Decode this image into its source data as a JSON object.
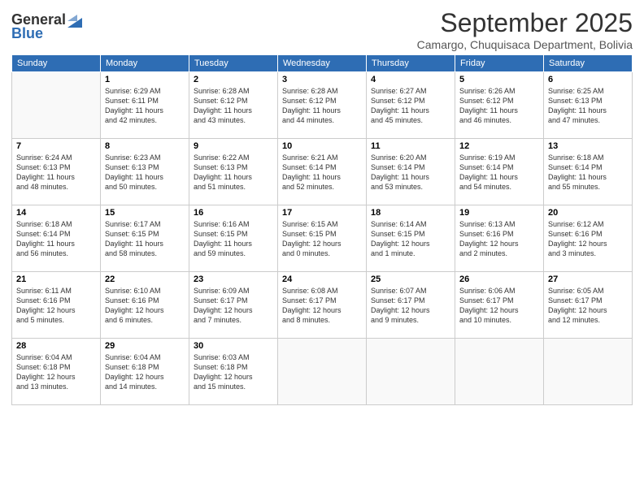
{
  "header": {
    "logo_line1": "General",
    "logo_line2": "Blue",
    "month": "September 2025",
    "location": "Camargo, Chuquisaca Department, Bolivia"
  },
  "days_of_week": [
    "Sunday",
    "Monday",
    "Tuesday",
    "Wednesday",
    "Thursday",
    "Friday",
    "Saturday"
  ],
  "weeks": [
    [
      {
        "day": "",
        "info": ""
      },
      {
        "day": "1",
        "info": "Sunrise: 6:29 AM\nSunset: 6:11 PM\nDaylight: 11 hours\nand 42 minutes."
      },
      {
        "day": "2",
        "info": "Sunrise: 6:28 AM\nSunset: 6:12 PM\nDaylight: 11 hours\nand 43 minutes."
      },
      {
        "day": "3",
        "info": "Sunrise: 6:28 AM\nSunset: 6:12 PM\nDaylight: 11 hours\nand 44 minutes."
      },
      {
        "day": "4",
        "info": "Sunrise: 6:27 AM\nSunset: 6:12 PM\nDaylight: 11 hours\nand 45 minutes."
      },
      {
        "day": "5",
        "info": "Sunrise: 6:26 AM\nSunset: 6:12 PM\nDaylight: 11 hours\nand 46 minutes."
      },
      {
        "day": "6",
        "info": "Sunrise: 6:25 AM\nSunset: 6:13 PM\nDaylight: 11 hours\nand 47 minutes."
      }
    ],
    [
      {
        "day": "7",
        "info": "Sunrise: 6:24 AM\nSunset: 6:13 PM\nDaylight: 11 hours\nand 48 minutes."
      },
      {
        "day": "8",
        "info": "Sunrise: 6:23 AM\nSunset: 6:13 PM\nDaylight: 11 hours\nand 50 minutes."
      },
      {
        "day": "9",
        "info": "Sunrise: 6:22 AM\nSunset: 6:13 PM\nDaylight: 11 hours\nand 51 minutes."
      },
      {
        "day": "10",
        "info": "Sunrise: 6:21 AM\nSunset: 6:14 PM\nDaylight: 11 hours\nand 52 minutes."
      },
      {
        "day": "11",
        "info": "Sunrise: 6:20 AM\nSunset: 6:14 PM\nDaylight: 11 hours\nand 53 minutes."
      },
      {
        "day": "12",
        "info": "Sunrise: 6:19 AM\nSunset: 6:14 PM\nDaylight: 11 hours\nand 54 minutes."
      },
      {
        "day": "13",
        "info": "Sunrise: 6:18 AM\nSunset: 6:14 PM\nDaylight: 11 hours\nand 55 minutes."
      }
    ],
    [
      {
        "day": "14",
        "info": "Sunrise: 6:18 AM\nSunset: 6:14 PM\nDaylight: 11 hours\nand 56 minutes."
      },
      {
        "day": "15",
        "info": "Sunrise: 6:17 AM\nSunset: 6:15 PM\nDaylight: 11 hours\nand 58 minutes."
      },
      {
        "day": "16",
        "info": "Sunrise: 6:16 AM\nSunset: 6:15 PM\nDaylight: 11 hours\nand 59 minutes."
      },
      {
        "day": "17",
        "info": "Sunrise: 6:15 AM\nSunset: 6:15 PM\nDaylight: 12 hours\nand 0 minutes."
      },
      {
        "day": "18",
        "info": "Sunrise: 6:14 AM\nSunset: 6:15 PM\nDaylight: 12 hours\nand 1 minute."
      },
      {
        "day": "19",
        "info": "Sunrise: 6:13 AM\nSunset: 6:16 PM\nDaylight: 12 hours\nand 2 minutes."
      },
      {
        "day": "20",
        "info": "Sunrise: 6:12 AM\nSunset: 6:16 PM\nDaylight: 12 hours\nand 3 minutes."
      }
    ],
    [
      {
        "day": "21",
        "info": "Sunrise: 6:11 AM\nSunset: 6:16 PM\nDaylight: 12 hours\nand 5 minutes."
      },
      {
        "day": "22",
        "info": "Sunrise: 6:10 AM\nSunset: 6:16 PM\nDaylight: 12 hours\nand 6 minutes."
      },
      {
        "day": "23",
        "info": "Sunrise: 6:09 AM\nSunset: 6:17 PM\nDaylight: 12 hours\nand 7 minutes."
      },
      {
        "day": "24",
        "info": "Sunrise: 6:08 AM\nSunset: 6:17 PM\nDaylight: 12 hours\nand 8 minutes."
      },
      {
        "day": "25",
        "info": "Sunrise: 6:07 AM\nSunset: 6:17 PM\nDaylight: 12 hours\nand 9 minutes."
      },
      {
        "day": "26",
        "info": "Sunrise: 6:06 AM\nSunset: 6:17 PM\nDaylight: 12 hours\nand 10 minutes."
      },
      {
        "day": "27",
        "info": "Sunrise: 6:05 AM\nSunset: 6:17 PM\nDaylight: 12 hours\nand 12 minutes."
      }
    ],
    [
      {
        "day": "28",
        "info": "Sunrise: 6:04 AM\nSunset: 6:18 PM\nDaylight: 12 hours\nand 13 minutes."
      },
      {
        "day": "29",
        "info": "Sunrise: 6:04 AM\nSunset: 6:18 PM\nDaylight: 12 hours\nand 14 minutes."
      },
      {
        "day": "30",
        "info": "Sunrise: 6:03 AM\nSunset: 6:18 PM\nDaylight: 12 hours\nand 15 minutes."
      },
      {
        "day": "",
        "info": ""
      },
      {
        "day": "",
        "info": ""
      },
      {
        "day": "",
        "info": ""
      },
      {
        "day": "",
        "info": ""
      }
    ]
  ]
}
